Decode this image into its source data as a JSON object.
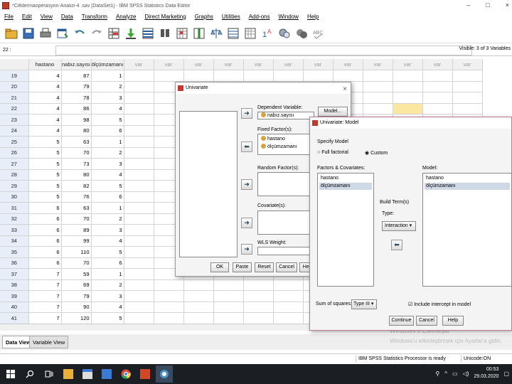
{
  "window": {
    "title": "*Ciltdermaoperasyon-Analizi-4 .sav [DataSet1] - IBM SPSS Statistics Data Editor",
    "controls": [
      "–",
      "□",
      "×"
    ]
  },
  "menu": [
    "File",
    "Edit",
    "View",
    "Data",
    "Transform",
    "Analyze",
    "Direct Marketing",
    "Graphs",
    "Utilities",
    "Add-ons",
    "Window",
    "Help"
  ],
  "toolbar_icons": [
    "open-icon",
    "save-icon",
    "print-icon",
    "dialog-recall-icon",
    "undo-icon",
    "redo-icon",
    "goto-case-icon",
    "goto-variable-icon",
    "variables-icon",
    "find-icon",
    "insert-cases-icon",
    "insert-variable-icon",
    "split-file-icon",
    "weight-cases-icon",
    "select-cases-icon",
    "value-labels-icon",
    "use-sets-icon",
    "show-all-icon",
    "spell-icon"
  ],
  "cellbar": {
    "ref": "22 :",
    "visible": "Visible: 3 of 3 Variables"
  },
  "grid": {
    "headers": [
      "hastano",
      "nabız.sayısı",
      "ölçümzamanı",
      "var",
      "var",
      "var",
      "var",
      "var",
      "var",
      "var",
      "var",
      "var",
      "var",
      "var",
      "var"
    ],
    "rows": [
      [
        "19",
        "4",
        "87",
        "1"
      ],
      [
        "20",
        "4",
        "79",
        "2"
      ],
      [
        "21",
        "4",
        "78",
        "3"
      ],
      [
        "22",
        "4",
        "86",
        "4"
      ],
      [
        "23",
        "4",
        "98",
        "5"
      ],
      [
        "24",
        "4",
        "80",
        "6"
      ],
      [
        "25",
        "5",
        "63",
        "1"
      ],
      [
        "26",
        "5",
        "70",
        "2"
      ],
      [
        "27",
        "5",
        "73",
        "3"
      ],
      [
        "28",
        "5",
        "80",
        "4"
      ],
      [
        "29",
        "5",
        "82",
        "5"
      ],
      [
        "30",
        "5",
        "76",
        "6"
      ],
      [
        "31",
        "6",
        "63",
        "1"
      ],
      [
        "32",
        "6",
        "70",
        "2"
      ],
      [
        "33",
        "6",
        "89",
        "3"
      ],
      [
        "34",
        "6",
        "99",
        "4"
      ],
      [
        "35",
        "6",
        "110",
        "5"
      ],
      [
        "36",
        "6",
        "70",
        "6"
      ],
      [
        "37",
        "7",
        "59",
        "1"
      ],
      [
        "38",
        "7",
        "69",
        "2"
      ],
      [
        "39",
        "7",
        "79",
        "3"
      ],
      [
        "40",
        "7",
        "90",
        "4"
      ],
      [
        "41",
        "7",
        "120",
        "5"
      ]
    ],
    "highlight_color": "#fbe7a0"
  },
  "tabs": {
    "data_view": "Data View",
    "variable_view": "Variable View"
  },
  "watermark": {
    "line1": "Windows'u Etkinleştir",
    "line2": "Windows'u etkinleştirmek için Ayarlar'a gidin."
  },
  "status": {
    "processor": "IBM SPSS Statistics Processor is ready",
    "unicode": "Unicode:ON"
  },
  "taskbar": {
    "time": "00:53",
    "date": "29.03.2020"
  },
  "univariate": {
    "title": "Univariate",
    "dependent_label": "Dependent Variable:",
    "dependent_value": "nabız.sayısı",
    "fixed_label": "Fixed Factor(s):",
    "fixed_items": [
      "hastano",
      "ölçümzamanı"
    ],
    "random_label": "Random Factor(s):",
    "covariates_label": "Covariate(s):",
    "wls_label": "WLS Weight:",
    "model_button": "Model...",
    "buttons": [
      "OK",
      "Paste",
      "Reset",
      "Cancel",
      "Help"
    ]
  },
  "model": {
    "title": "Univariate: Model",
    "specify_label": "Specify Model",
    "full_factorial": "Full factorial",
    "custom": "Custom",
    "factors_label": "Factors & Covariates:",
    "factors": [
      "hastano",
      "ölçümzamanı"
    ],
    "model_label": "Model:",
    "model_items": [
      "hastano",
      "ölçümzamanı"
    ],
    "build_label": "Build Term(s)",
    "type_label": "Type:",
    "type_value": "Interaction",
    "sum_label": "Sum of squares:",
    "sum_value": "Type III",
    "include_intercept": "Include intercept in model",
    "buttons": [
      "Continue",
      "Cancel",
      "Help"
    ]
  }
}
